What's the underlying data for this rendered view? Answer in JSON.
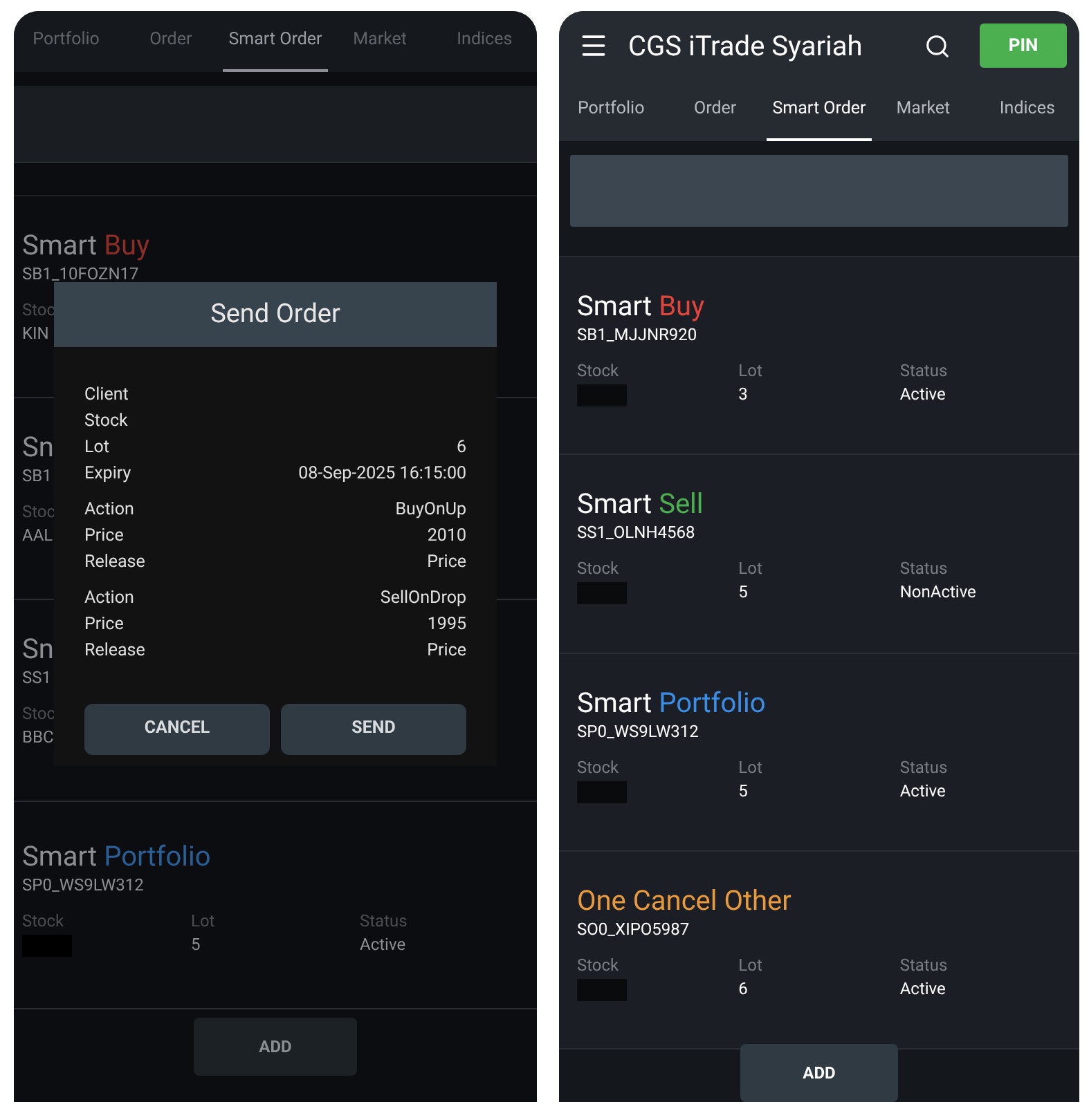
{
  "left_screen": {
    "tabs": [
      {
        "label": "Portfolio",
        "selected": false
      },
      {
        "label": "Order",
        "selected": false
      },
      {
        "label": "Smart Order",
        "selected": true
      },
      {
        "label": "Market",
        "selected": false
      },
      {
        "label": "Indices",
        "selected": false
      }
    ],
    "cards": [
      {
        "title": "Smart",
        "accent": "Buy",
        "color": "#8a2d26",
        "id": "SB1_10FOZN17",
        "stats": [
          {
            "label": "Stoc",
            "value": "KIN"
          }
        ]
      },
      {
        "title": "Sn",
        "id": "SB1",
        "stats": [
          {
            "label": "Stoc",
            "value": "AAL"
          }
        ]
      },
      {
        "title": "Sn",
        "id": "SS1",
        "stats": [
          {
            "label": "Stoc",
            "value": "BBC"
          }
        ]
      },
      {
        "title": "Smart",
        "accent": "Portfolio",
        "color": "#2a5f96",
        "id": "SP0_WS9LW312",
        "stats": [
          {
            "label": "Stock",
            "redacted": true
          },
          {
            "label": "Lot",
            "value": "5"
          },
          {
            "label": "Status",
            "value": "Active"
          }
        ]
      }
    ],
    "add_button": "ADD",
    "dialog": {
      "title": "Send Order",
      "groups": [
        [
          {
            "label": "Client"
          },
          {
            "label": "Stock"
          },
          {
            "label": "Lot",
            "value": "6"
          },
          {
            "label": "Expiry",
            "value": "08-Sep-2025 16:15:00"
          }
        ],
        [
          {
            "label": "Action",
            "value": "BuyOnUp"
          },
          {
            "label": "Price",
            "value": "2010"
          },
          {
            "label": "Release",
            "value": "Price"
          }
        ],
        [
          {
            "label": "Action",
            "value": "SellOnDrop"
          },
          {
            "label": "Price",
            "value": "1995"
          },
          {
            "label": "Release",
            "value": "Price"
          }
        ]
      ],
      "buttons": [
        "CANCEL",
        "SEND"
      ]
    }
  },
  "right_screen": {
    "title": "CGS iTrade Syariah",
    "pin_button": "PIN",
    "tabs": [
      {
        "label": "Portfolio",
        "selected": false
      },
      {
        "label": "Order",
        "selected": false
      },
      {
        "label": "Smart Order",
        "selected": true
      },
      {
        "label": "Market",
        "selected": false
      },
      {
        "label": "Indices",
        "selected": false
      }
    ],
    "cards": [
      {
        "title": "Smart",
        "accent": "Buy",
        "color": "#e0443a",
        "id": "SB1_MJJNR920",
        "stats": [
          {
            "label": "Stock",
            "redacted": true
          },
          {
            "label": "Lot",
            "value": "3"
          },
          {
            "label": "Status",
            "value": "Active"
          }
        ]
      },
      {
        "title": "Smart",
        "accent": "Sell",
        "color": "#4caf50",
        "id": "SS1_OLNH4568",
        "stats": [
          {
            "label": "Stock",
            "redacted": true
          },
          {
            "label": "Lot",
            "value": "5"
          },
          {
            "label": "Status",
            "value": "NonActive"
          }
        ]
      },
      {
        "title": "Smart",
        "accent": "Portfolio",
        "color": "#3a8ee6",
        "id": "SP0_WS9LW312",
        "stats": [
          {
            "label": "Stock",
            "redacted": true
          },
          {
            "label": "Lot",
            "value": "5"
          },
          {
            "label": "Status",
            "value": "Active"
          }
        ]
      },
      {
        "accent": "One Cancel Other",
        "color": "#e89a3c",
        "id": "SO0_XIPO5987",
        "stats": [
          {
            "label": "Stock",
            "redacted": true
          },
          {
            "label": "Lot",
            "value": "6"
          },
          {
            "label": "Status",
            "value": "Active"
          }
        ]
      }
    ],
    "add_button": "ADD"
  }
}
